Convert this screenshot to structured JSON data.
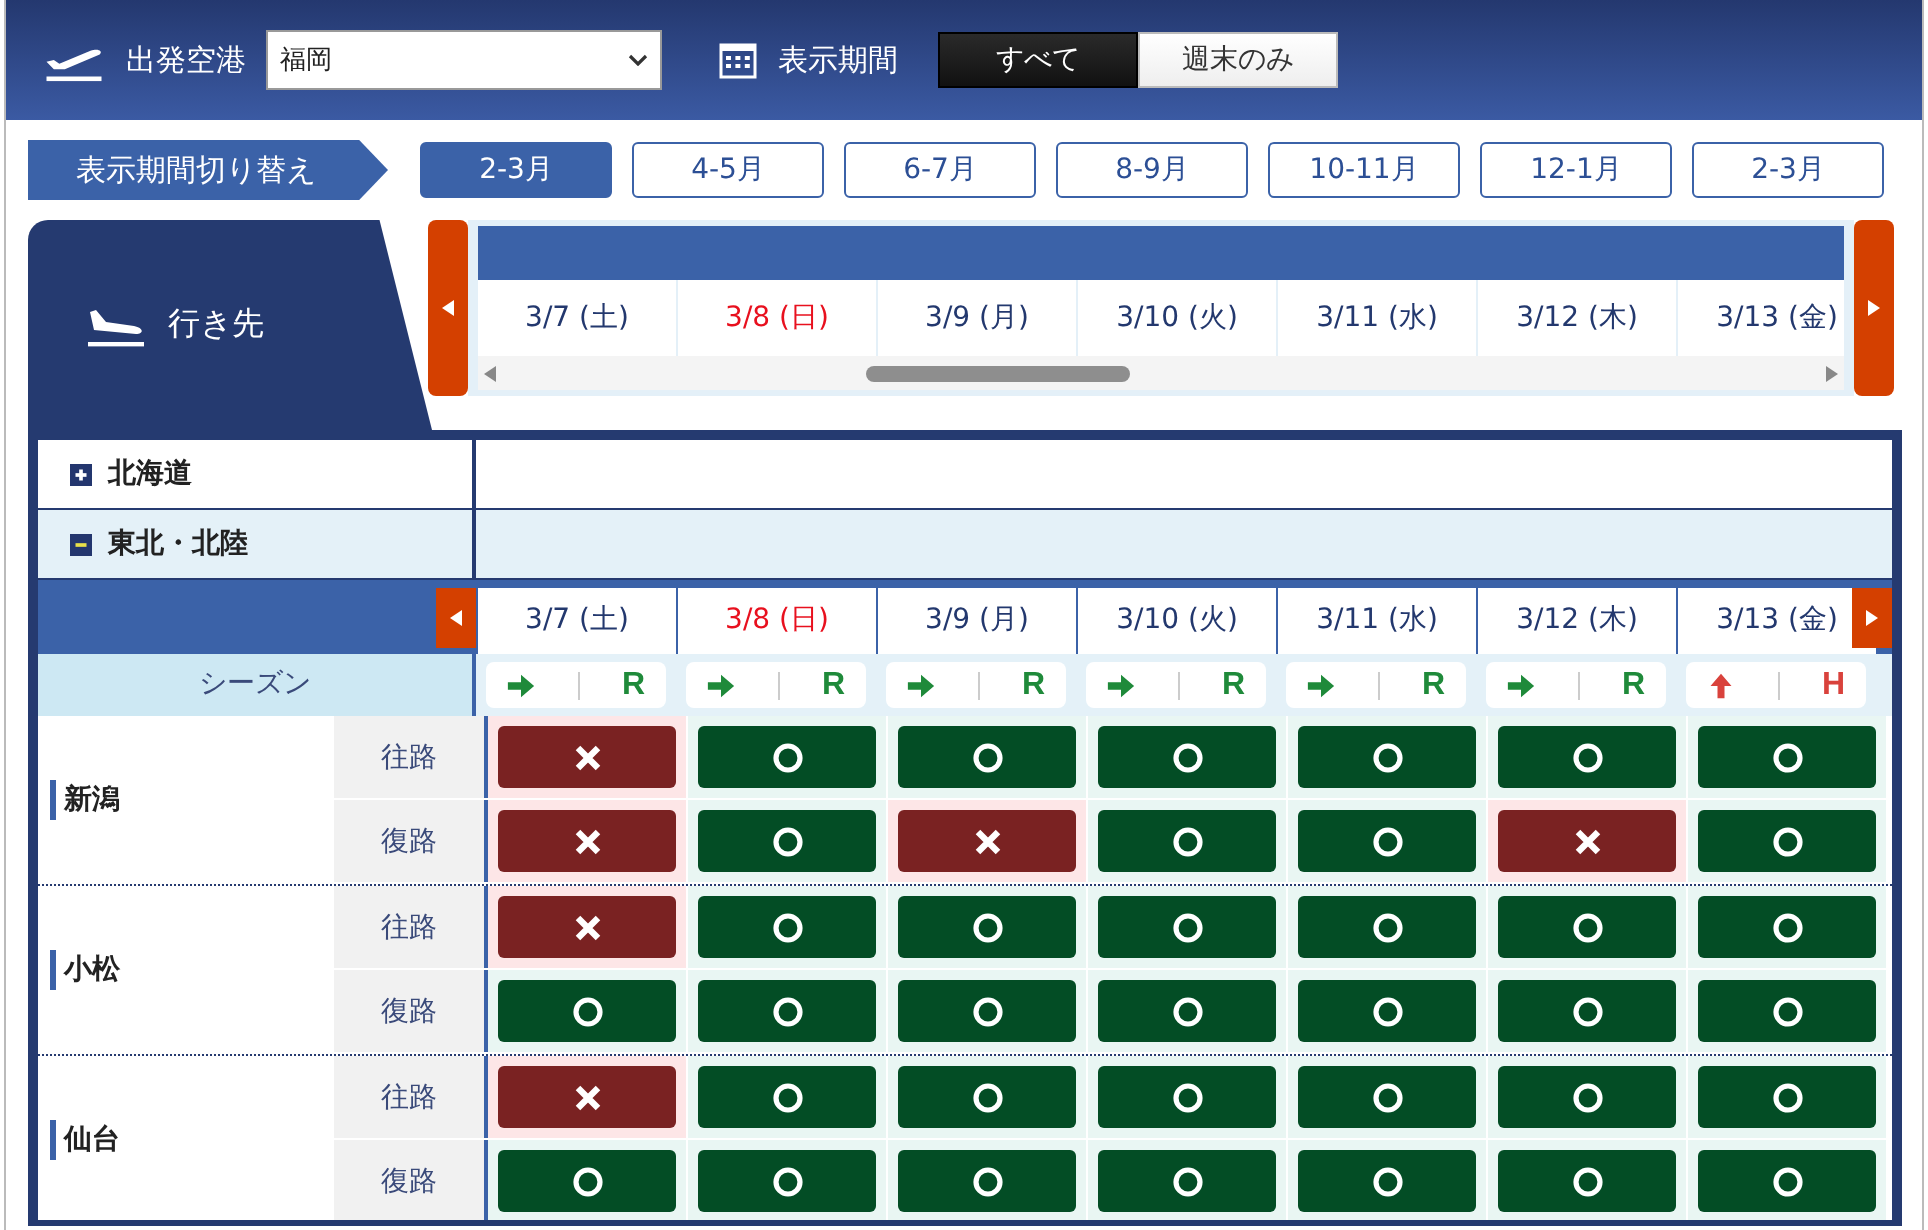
{
  "header": {
    "departure_label": "出発空港",
    "departure_airport": "福岡",
    "period_label": "表示期間",
    "display_options": [
      {
        "label": "すべて",
        "selected": true
      },
      {
        "label": "週末のみ",
        "selected": false
      }
    ]
  },
  "period_switch": {
    "label": "表示期間切り替え",
    "periods": [
      {
        "label": "2-3月",
        "selected": true
      },
      {
        "label": "4-5月",
        "selected": false
      },
      {
        "label": "6-7月",
        "selected": false
      },
      {
        "label": "8-9月",
        "selected": false
      },
      {
        "label": "10-11月",
        "selected": false
      },
      {
        "label": "12-1月",
        "selected": false
      },
      {
        "label": "2-3月",
        "selected": false
      }
    ]
  },
  "destination_label": "行き先",
  "top_dates": [
    {
      "label": "3/7 (土)",
      "holiday": false
    },
    {
      "label": "3/8 (日)",
      "holiday": true
    },
    {
      "label": "3/9 (月)",
      "holiday": false
    },
    {
      "label": "3/10 (火)",
      "holiday": false
    },
    {
      "label": "3/11 (水)",
      "holiday": false
    },
    {
      "label": "3/12 (木)",
      "holiday": false
    },
    {
      "label": "3/13 (金)",
      "holiday": false
    }
  ],
  "regions": [
    {
      "name": "北海道",
      "expanded": false
    },
    {
      "name": "東北・北陸",
      "expanded": true,
      "dates": [
        {
          "label": "3/7 (土)",
          "holiday": false
        },
        {
          "label": "3/8 (日)",
          "holiday": true
        },
        {
          "label": "3/9 (月)",
          "holiday": false
        },
        {
          "label": "3/10 (火)",
          "holiday": false
        },
        {
          "label": "3/11 (水)",
          "holiday": false
        },
        {
          "label": "3/12 (木)",
          "holiday": false
        },
        {
          "label": "3/13 (金)",
          "holiday": false
        }
      ],
      "season_label": "シーズン",
      "seasons": [
        {
          "kind": "regular",
          "code": "R"
        },
        {
          "kind": "regular",
          "code": "R"
        },
        {
          "kind": "regular",
          "code": "R"
        },
        {
          "kind": "regular",
          "code": "R"
        },
        {
          "kind": "regular",
          "code": "R"
        },
        {
          "kind": "regular",
          "code": "R"
        },
        {
          "kind": "high",
          "code": "H"
        }
      ],
      "cities": [
        {
          "name": "新潟",
          "routes": [
            {
              "label": "往路",
              "available": [
                false,
                true,
                true,
                true,
                true,
                true,
                true
              ]
            },
            {
              "label": "復路",
              "available": [
                false,
                true,
                false,
                true,
                true,
                false,
                true
              ]
            }
          ]
        },
        {
          "name": "小松",
          "routes": [
            {
              "label": "往路",
              "available": [
                false,
                true,
                true,
                true,
                true,
                true,
                true
              ]
            },
            {
              "label": "復路",
              "available": [
                true,
                true,
                true,
                true,
                true,
                true,
                true
              ]
            }
          ]
        },
        {
          "name": "仙台",
          "routes": [
            {
              "label": "往路",
              "available": [
                false,
                true,
                true,
                true,
                true,
                true,
                true
              ]
            },
            {
              "label": "復路",
              "available": [
                true,
                true,
                true,
                true,
                true,
                true,
                true
              ]
            }
          ]
        }
      ]
    }
  ]
}
